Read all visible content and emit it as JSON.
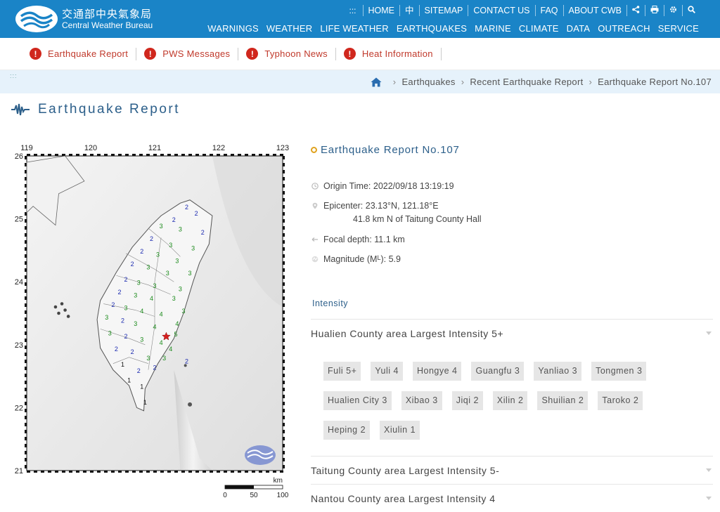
{
  "header": {
    "logo_zh": "交通部中央氣象局",
    "logo_en": "Central Weather Bureau",
    "utility": [
      "HOME",
      "中",
      "SITEMAP",
      "CONTACT US",
      "FAQ",
      "ABOUT CWB"
    ],
    "utility_icons": [
      "share-icon",
      "print-icon",
      "gear-icon",
      "search-icon"
    ],
    "nav": [
      "WARNINGS",
      "WEATHER",
      "LIFE WEATHER",
      "EARTHQUAKES",
      "MARINE",
      "CLIMATE",
      "DATA",
      "OUTREACH",
      "SERVICE"
    ]
  },
  "alerts": [
    "Earthquake Report",
    "PWS Messages",
    "Typhoon News",
    "Heat Information"
  ],
  "breadcrumb": {
    "dots": ":::",
    "items": [
      "Earthquakes",
      "Recent Earthquake Report",
      "Earthquake Report No.107"
    ]
  },
  "page_title": "Earthquake Report",
  "map": {
    "x_ticks": [
      "119",
      "120",
      "121",
      "122",
      "123"
    ],
    "y_ticks": [
      "26",
      "25",
      "24",
      "23",
      "22",
      "21"
    ],
    "scale_unit": "km",
    "scale_labels": [
      "0",
      "50",
      "100"
    ],
    "epicenter": {
      "lon": 121.18,
      "lat": 23.13
    }
  },
  "report": {
    "title": "Earthquake Report No.107",
    "origin_label": "Origin Time:",
    "origin_value": "2022/09/18 13:19:19",
    "epicenter_label": "Epicenter:",
    "epicenter_value": "23.13°N, 121.18°E",
    "epicenter_desc": "41.8 km N of Taitung County Hall",
    "depth_label": "Focal depth:",
    "depth_value": "11.1 km",
    "magnitude_label": "Magnitude (M",
    "magnitude_sub": "L",
    "magnitude_close": "):",
    "magnitude_value": "5.9"
  },
  "intensity": {
    "heading": "Intensity",
    "areas": [
      {
        "title": "Hualien County area Largest Intensity 5+",
        "stations": [
          "Fuli 5+",
          "Yuli 4",
          "Hongye 4",
          "Guangfu 3",
          "Yanliao 3",
          "Tongmen 3",
          "Hualien City 3",
          "Xibao 3",
          "Jiqi 2",
          "Xilin 2",
          "Shuilian 2",
          "Taroko 2",
          "Heping 2",
          "Xiulin 1"
        ]
      },
      {
        "title": "Taitung County area Largest Intensity 5-"
      },
      {
        "title": "Nantou County area Largest Intensity 4"
      }
    ]
  },
  "colors": {
    "header": "#1a84c7",
    "alert": "#d0271d",
    "accent": "#2c5f8a",
    "ring": "#e0a21e"
  }
}
